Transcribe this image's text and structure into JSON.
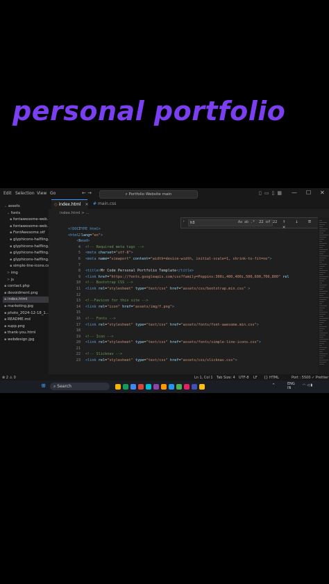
{
  "headline": "personal portfolio",
  "titlebar": {
    "menu": [
      "Edit",
      "Selection",
      "View",
      "Go"
    ],
    "nav_arrows": "← →",
    "search": "Portfolio Website main",
    "window_controls": [
      "—",
      "☐",
      "✕"
    ]
  },
  "sidebar": {
    "items": [
      {
        "label": "assets",
        "indent": 0,
        "caret": "⌄"
      },
      {
        "label": "fonts",
        "indent": 1,
        "caret": "⌄"
      },
      {
        "label": "fontawesome-web...",
        "indent": 2,
        "caret": ""
      },
      {
        "label": "fontawesome-web...",
        "indent": 2,
        "caret": ""
      },
      {
        "label": "FontAwesome.otf",
        "indent": 2,
        "caret": ""
      },
      {
        "label": "glyphicons-halfling...",
        "indent": 2,
        "caret": ""
      },
      {
        "label": "glyphicons-halfling...",
        "indent": 2,
        "caret": ""
      },
      {
        "label": "glyphicons-halfling...",
        "indent": 2,
        "caret": ""
      },
      {
        "label": "glyphicons-halfling...",
        "indent": 2,
        "caret": ""
      },
      {
        "label": "simple-line-icons.css",
        "indent": 2,
        "caret": ""
      },
      {
        "label": "img",
        "indent": 1,
        "caret": ">"
      },
      {
        "label": "js",
        "indent": 1,
        "caret": ">"
      },
      {
        "label": "contact.php",
        "indent": 0,
        "caret": ""
      },
      {
        "label": "devoidment.png",
        "indent": 0,
        "caret": ""
      },
      {
        "label": "index.html",
        "indent": 0,
        "caret": "",
        "selected": true
      },
      {
        "label": "marketing.jpg",
        "indent": 0,
        "caret": ""
      },
      {
        "label": "photo_2024-12-18_1...",
        "indent": 0,
        "caret": ""
      },
      {
        "label": "README.md",
        "indent": 0,
        "caret": ""
      },
      {
        "label": "supp.png",
        "indent": 0,
        "caret": ""
      },
      {
        "label": "thank-you.html",
        "indent": 0,
        "caret": ""
      },
      {
        "label": "webdesign.jpg",
        "indent": 0,
        "caret": ""
      }
    ]
  },
  "tabs": [
    {
      "label": "index.html",
      "active": true
    },
    {
      "label": "main.css",
      "active": false
    }
  ],
  "breadcrumb": "index.html > ...",
  "find": {
    "query": "h3",
    "options": "Aa ab .*",
    "count": "22 of 22",
    "buttons": "↑ ↓ ≡ ✕"
  },
  "code_lines": [
    {
      "n": "1",
      "parts": [
        [
          "t",
          "<!DOCTYPE html>"
        ]
      ]
    },
    {
      "n": "2",
      "parts": [
        [
          "t",
          "<html "
        ],
        [
          "a",
          "lang"
        ],
        [
          "x",
          "="
        ],
        [
          "s",
          "\"en\""
        ],
        [
          "t",
          ">"
        ]
      ]
    },
    {
      "n": "3",
      "parts": [
        [
          "x",
          "    "
        ],
        [
          "t",
          "<head>"
        ]
      ]
    },
    {
      "n": "4",
      "parts": [
        [
          "x",
          "        "
        ],
        [
          "c",
          "<!-- Required meta tags -->"
        ]
      ]
    },
    {
      "n": "5",
      "parts": [
        [
          "x",
          "        "
        ],
        [
          "t",
          "<meta "
        ],
        [
          "a",
          "charset"
        ],
        [
          "x",
          "="
        ],
        [
          "s",
          "\"utf-8\""
        ],
        [
          "t",
          ">"
        ]
      ]
    },
    {
      "n": "6",
      "parts": [
        [
          "x",
          "        "
        ],
        [
          "t",
          "<meta "
        ],
        [
          "a",
          "name"
        ],
        [
          "x",
          "="
        ],
        [
          "s",
          "\"viewport\""
        ],
        [
          "a",
          " content"
        ],
        [
          "x",
          "="
        ],
        [
          "s",
          "\"width=device-width, initial-scale=1, shrink-to-fit=no\""
        ],
        [
          "t",
          ">"
        ]
      ]
    },
    {
      "n": "7",
      "parts": [
        [
          "x",
          ""
        ]
      ]
    },
    {
      "n": "8",
      "parts": [
        [
          "x",
          "        "
        ],
        [
          "t",
          "<title>"
        ],
        [
          "x",
          "Mr Code Personal Portfolio Template"
        ],
        [
          "t",
          "</title>"
        ]
      ]
    },
    {
      "n": "9",
      "parts": [
        [
          "x",
          "        "
        ],
        [
          "t",
          "<link "
        ],
        [
          "a",
          "href"
        ],
        [
          "x",
          "="
        ],
        [
          "s",
          "\"https://fonts.googleapis.com/css?family=Poppins:300i,400,400i,500,600,700,800\""
        ],
        [
          "a",
          " rel"
        ]
      ]
    },
    {
      "n": "10",
      "parts": [
        [
          "x",
          "        "
        ],
        [
          "c",
          "<!-- Bootstrap CSS -->"
        ]
      ]
    },
    {
      "n": "11",
      "parts": [
        [
          "x",
          "        "
        ],
        [
          "t",
          "<link "
        ],
        [
          "a",
          "rel"
        ],
        [
          "x",
          "="
        ],
        [
          "s",
          "\"stylesheet\""
        ],
        [
          "a",
          " type"
        ],
        [
          "x",
          "="
        ],
        [
          "s",
          "\"text/css\""
        ],
        [
          "a",
          " href"
        ],
        [
          "x",
          "="
        ],
        [
          "s",
          "\"assets/css/bootstrap.min.css\""
        ],
        [
          "t",
          " >"
        ]
      ]
    },
    {
      "n": "12",
      "parts": [
        [
          "x",
          ""
        ]
      ]
    },
    {
      "n": "13",
      "parts": [
        [
          "x",
          "        "
        ],
        [
          "c",
          "<!--Favicon for this site -->"
        ]
      ]
    },
    {
      "n": "14",
      "parts": [
        [
          "x",
          "        "
        ],
        [
          "t",
          "<link "
        ],
        [
          "a",
          "rel"
        ],
        [
          "x",
          "="
        ],
        [
          "s",
          "\"icon\""
        ],
        [
          "a",
          " href"
        ],
        [
          "x",
          "="
        ],
        [
          "s",
          "\"assets/img/f.png\""
        ],
        [
          "t",
          ">"
        ]
      ]
    },
    {
      "n": "15",
      "parts": [
        [
          "x",
          ""
        ]
      ]
    },
    {
      "n": "16",
      "parts": [
        [
          "x",
          "        "
        ],
        [
          "c",
          "<!-- Fonts -->"
        ]
      ]
    },
    {
      "n": "17",
      "parts": [
        [
          "x",
          "        "
        ],
        [
          "t",
          "<link "
        ],
        [
          "a",
          "rel"
        ],
        [
          "x",
          "="
        ],
        [
          "s",
          "\"stylesheet\""
        ],
        [
          "a",
          " type"
        ],
        [
          "x",
          "="
        ],
        [
          "s",
          "\"text/css\""
        ],
        [
          "a",
          " href"
        ],
        [
          "x",
          "="
        ],
        [
          "s",
          "\"assets/fonts/font-awesome.min.css\""
        ],
        [
          "t",
          ">"
        ]
      ]
    },
    {
      "n": "18",
      "parts": [
        [
          "x",
          ""
        ]
      ]
    },
    {
      "n": "19",
      "parts": [
        [
          "x",
          "        "
        ],
        [
          "c",
          "<!-- Icon -->"
        ]
      ]
    },
    {
      "n": "20",
      "parts": [
        [
          "x",
          "        "
        ],
        [
          "t",
          "<link "
        ],
        [
          "a",
          "rel"
        ],
        [
          "x",
          "="
        ],
        [
          "s",
          "\"stylesheet\""
        ],
        [
          "a",
          " type"
        ],
        [
          "x",
          "="
        ],
        [
          "s",
          "\"text/css\""
        ],
        [
          "a",
          " href"
        ],
        [
          "x",
          "="
        ],
        [
          "s",
          "\"assets/fonts/simple-line-icons.css\""
        ],
        [
          "t",
          ">"
        ]
      ]
    },
    {
      "n": "21",
      "parts": [
        [
          "x",
          ""
        ]
      ]
    },
    {
      "n": "22",
      "parts": [
        [
          "x",
          "        "
        ],
        [
          "c",
          "<!-- Slicknav -->"
        ]
      ]
    },
    {
      "n": "23",
      "parts": [
        [
          "x",
          "        "
        ],
        [
          "t",
          "<link "
        ],
        [
          "a",
          "rel"
        ],
        [
          "x",
          "="
        ],
        [
          "s",
          "\"stylesheet\""
        ],
        [
          "a",
          " type"
        ],
        [
          "x",
          "="
        ],
        [
          "s",
          "\"text/css\""
        ],
        [
          "a",
          " href"
        ],
        [
          "x",
          "="
        ],
        [
          "s",
          "\"assets/css/slicknav.css\""
        ],
        [
          "t",
          ">"
        ]
      ]
    }
  ],
  "status": {
    "left": "⊗ 2  ⚠ 0",
    "position": "Ln 1, Col 1",
    "tab_size": "Tab Size: 4",
    "encoding": "UTF-8",
    "eol": "LF",
    "language": "{} HTML",
    "port": "Port : 5500",
    "prettier": "✓ Prettier"
  },
  "taskbar": {
    "search": "Search",
    "app_colors": [
      "#f4b400",
      "#0f9d58",
      "#4285f4",
      "#db4437",
      "#00bcd4",
      "#8e44ad",
      "#ff9800",
      "#2196f3",
      "#4caf50",
      "#e91e63",
      "#3f51b5",
      "#ffc107"
    ],
    "tray_lang": "ENG",
    "tray_region": "IN"
  },
  "colors": {
    "accent": "#7b3ff2",
    "editor_bg": "#1f1f1f",
    "tab_accent": "#3794ff"
  }
}
